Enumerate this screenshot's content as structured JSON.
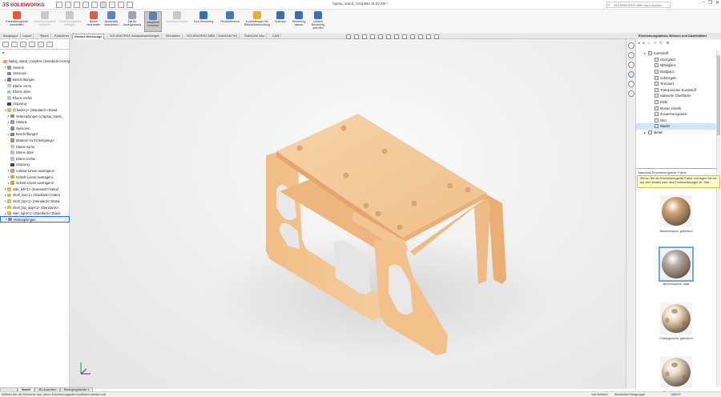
{
  "app": {
    "brand_ds": "3S",
    "brand_name": "SOLIDWORKS",
    "doc_title": "laptop_stand_complete.SLDASM *",
    "search_placeholder": "SOLIDWORKS-Hilfe durchsuchen"
  },
  "ribbon": [
    {
      "label": "Erscheinungsbild\nbearbeiten",
      "icon": "appearance-icon",
      "color": "#e35b3f",
      "dim": false
    },
    {
      "label": "Erscheinungsbild\nkopieren",
      "icon": "copy-appearance-icon",
      "color": "#c9c9c9",
      "dim": true
    },
    {
      "label": "Erscheinungsbild\neinfügen",
      "icon": "paste-appearance-icon",
      "color": "#c9c9c9",
      "dim": true
    },
    {
      "label": "Bühne\nbearbeiten",
      "icon": "scene-icon",
      "color": "#d8604a",
      "dim": false
    },
    {
      "label": "Abziehbild\nbearbeiten",
      "icon": "decal-icon",
      "color": "#5a86c2",
      "dim": false
    },
    {
      "label": "Ziel für\nAnzeigestatus",
      "icon": "display-state-icon",
      "color": "#9aa6b3",
      "dim": false
    },
    {
      "label": "Integrierte\nVorschau",
      "icon": "integrated-preview-icon",
      "color": "#5f7fb0",
      "dim": false,
      "active": true
    },
    {
      "label": "Vorschau-Fenster",
      "icon": "preview-window-icon",
      "color": "#c9c9c9",
      "dim": true
    },
    {
      "label": "End-Rendering",
      "icon": "final-render-icon",
      "color": "#3a6fb5",
      "dim": false
    },
    {
      "label": "Renderbereich",
      "icon": "render-region-icon",
      "color": "#4778bb",
      "dim": false
    },
    {
      "label": "Kontrollbogen für\nBühnenbeleuchtung",
      "icon": "lighting-icon",
      "color": "#e0b234",
      "dim": false
    },
    {
      "label": "Optionen",
      "icon": "options-icon",
      "color": "#3a6fb5",
      "dim": false
    },
    {
      "label": "Rendering\nplanen",
      "icon": "schedule-render-icon",
      "color": "#3a6fb5",
      "dim": false
    },
    {
      "label": "Letztes\nRendering\naufrufen",
      "icon": "recall-render-icon",
      "color": "#3a6fb5",
      "dim": false
    }
  ],
  "tabs": [
    "Baugruppe",
    "Layout",
    "Skizze",
    "Evaluieren",
    "Render-Werkzeuge",
    "SOLIDWORKS Zusatzanwendungen",
    "Simulation",
    "SOLIDWORKS MBD",
    "SolidCAM Tell",
    "SolidCAM Inbo",
    "CAM"
  ],
  "selected_tab": "Render-Werkzeuge",
  "tree": [
    {
      "label": "laptop_stand_complete  (Standard<Anzeig",
      "indent": 0,
      "exp": "",
      "icon": "#e9a24a"
    },
    {
      "label": "Historie",
      "indent": 1,
      "exp": "▸",
      "icon": "#9c9c9c"
    },
    {
      "label": "Sensoren",
      "indent": 1,
      "exp": "",
      "icon": "#6b8fbf"
    },
    {
      "label": "Beschriftungen",
      "indent": 1,
      "exp": "▸",
      "icon": "#7b7b7b"
    },
    {
      "label": "Ebene vorne",
      "indent": 1,
      "exp": "",
      "icon": "#b2c1d4"
    },
    {
      "label": "Ebene oben",
      "indent": 1,
      "exp": "",
      "icon": "#b2c1d4"
    },
    {
      "label": "Ebene rechts",
      "indent": 1,
      "exp": "",
      "icon": "#b2c1d4"
    },
    {
      "label": "Ursprung",
      "indent": 1,
      "exp": "",
      "icon": "#444444"
    },
    {
      "label": "(f) back<1> (Standard<<Stand",
      "indent": 1,
      "exp": "▾",
      "icon": "#e7b545"
    },
    {
      "label": "Verknüpfungen in laptop_stand_",
      "indent": 2,
      "exp": "▸",
      "icon": "#8a8a8a"
    },
    {
      "label": "Historie",
      "indent": 2,
      "exp": "▸",
      "icon": "#9c9c9c"
    },
    {
      "label": "Sensoren",
      "indent": 2,
      "exp": "",
      "icon": "#6b8fbf"
    },
    {
      "label": "Beschriftungen",
      "indent": 2,
      "exp": "▸",
      "icon": "#7b7b7b"
    },
    {
      "label": "Material <nicht festgelegt>",
      "indent": 2,
      "exp": "",
      "icon": "#a08f70"
    },
    {
      "label": "Ebene vorne",
      "indent": 2,
      "exp": "",
      "icon": "#b2c1d4"
    },
    {
      "label": "Ebene oben",
      "indent": 2,
      "exp": "",
      "icon": "#b2c1d4"
    },
    {
      "label": "Ebene rechts",
      "indent": 2,
      "exp": "",
      "icon": "#b2c1d4"
    },
    {
      "label": "Ursprung",
      "indent": 2,
      "exp": "",
      "icon": "#444444"
    },
    {
      "label": "Aufsatz-Linear austragen1",
      "indent": 2,
      "exp": "▸",
      "icon": "#d89a4a"
    },
    {
      "label": "Schnitt-Linear austragen1",
      "indent": 2,
      "exp": "▸",
      "icon": "#d89a4a"
    },
    {
      "label": "Schnitt-Linear austragen2",
      "indent": 2,
      "exp": "▸",
      "icon": "#d89a4a"
    },
    {
      "label": "side_left<1> (Standard<<Stand",
      "indent": 1,
      "exp": "▸",
      "icon": "#e7b545"
    },
    {
      "label": "shelf_low<1> (Standard<<Stand",
      "indent": 1,
      "exp": "▸",
      "icon": "#e7b545"
    },
    {
      "label": "shelf_top<1> (Standard<<Stand",
      "indent": 1,
      "exp": "▸",
      "icon": "#e7b545"
    },
    {
      "label": "shelf_top_stop<1> (Standard<<",
      "indent": 1,
      "exp": "▸",
      "icon": "#e7b545"
    },
    {
      "label": "side_right<1> (Standard<<Stand",
      "indent": 1,
      "exp": "▸",
      "icon": "#e7b545"
    },
    {
      "label": "Verknüpfungen",
      "indent": 1,
      "exp": "▸",
      "icon": "#8a8a8a"
    }
  ],
  "bottom_tabs": [
    "Modell",
    "3D-Ansichten",
    "Bewegungsstudie 1"
  ],
  "status": {
    "left": "Wählen Sie die Elemente aus, deren Erscheinungsbild modifiziert werden soll",
    "defined": "Voll definiert",
    "editing": "Bearbeiten Baugruppe",
    "units": "MMGS"
  },
  "appearances": {
    "title": "Erscheinungsbilder, Bühnen und Abziehbilder",
    "tree": [
      {
        "label": "Kunststoff",
        "indent": 1,
        "exp": "▾"
      },
      {
        "label": "Hochglanz",
        "indent": 2,
        "exp": ""
      },
      {
        "label": "Mittelglanz",
        "indent": 2,
        "exp": ""
      },
      {
        "label": "Mattglanz",
        "indent": 2,
        "exp": ""
      },
      {
        "label": "Schmirgeln",
        "indent": 2,
        "exp": ""
      },
      {
        "label": "Texturiert",
        "indent": 2,
        "exp": ""
      },
      {
        "label": "Transparenter Kunststoff",
        "indent": 2,
        "exp": ""
      },
      {
        "label": "Satinierte Oberfläche",
        "indent": 2,
        "exp": ""
      },
      {
        "label": "EDM",
        "indent": 2,
        "exp": ""
      },
      {
        "label": "Muster erstellt",
        "indent": 2,
        "exp": ""
      },
      {
        "label": "Zusammengesetzt",
        "indent": 2,
        "exp": ""
      },
      {
        "label": "Netz",
        "indent": 2,
        "exp": ""
      },
      {
        "label": "Wachs",
        "indent": 2,
        "exp": "",
        "selected": true
      },
      {
        "label": "Metall",
        "indent": 1,
        "exp": "▸"
      }
    ],
    "label": "Standard-Erscheinungsbild: Farbe",
    "tooltip": "Ziehen Sie die Erscheinungsbild-Farbe und legen Sie sie auf dem Modell oder dem FeatureManager ab. Halt...",
    "swatches": [
      {
        "caption": "Bienenwachs, glänzend",
        "color": "#d6a374",
        "holes": false,
        "selected": false
      },
      {
        "caption": "Bienenwachs, matt",
        "color": "#b5ada4",
        "holes": false,
        "selected": true
      },
      {
        "caption": "Flüssigwachs, glänzend",
        "color": "#f2dcc0",
        "holes": true,
        "selected": false
      },
      {
        "caption": "Flüssigwachs, matt",
        "color": "#ecdcc8",
        "holes": true,
        "selected": false
      }
    ]
  },
  "colors": {
    "model": "#f2c492",
    "model_shade": "#e7ac72",
    "model_top": "#f6cfa2",
    "accent": "#1f73d6"
  }
}
